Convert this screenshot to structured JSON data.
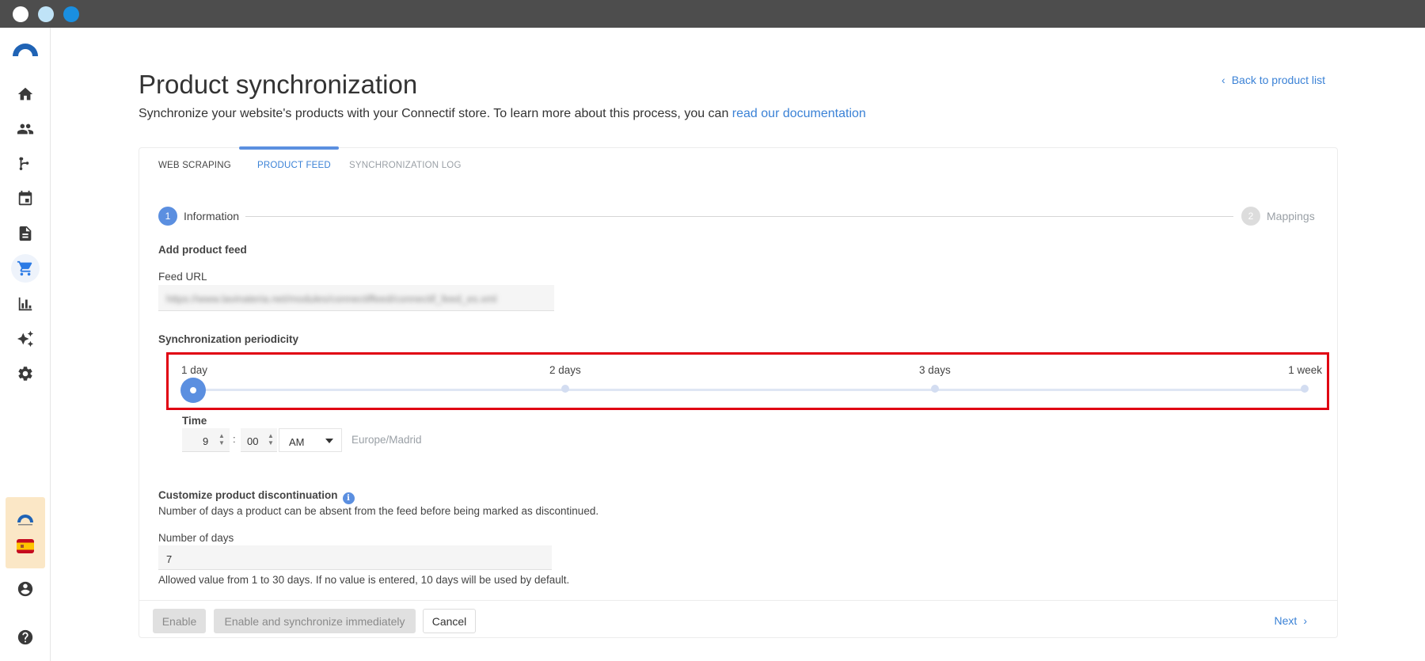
{
  "window": {
    "title": ""
  },
  "sidebar": {
    "items": [
      {
        "name": "home-icon"
      },
      {
        "name": "contacts-icon"
      },
      {
        "name": "workflow-icon"
      },
      {
        "name": "calendar-icon"
      },
      {
        "name": "document-icon"
      },
      {
        "name": "cart-icon",
        "active": true
      },
      {
        "name": "chart-icon"
      },
      {
        "name": "sparkle-icon"
      },
      {
        "name": "gear-icon"
      }
    ],
    "bottom": [
      {
        "name": "user-icon"
      },
      {
        "name": "help-icon"
      }
    ]
  },
  "header": {
    "title": "Product synchronization",
    "subtitle_text": "Synchronize your website's products with your Connectif store. To learn more about this process, you can ",
    "subtitle_link": "read our documentation",
    "back_link": "Back to product list"
  },
  "tabs": [
    {
      "label": "WEB SCRAPING",
      "state": "normal"
    },
    {
      "label": "PRODUCT FEED",
      "state": "active"
    },
    {
      "label": "SYNCHRONIZATION LOG",
      "state": "muted"
    }
  ],
  "stepper": {
    "steps": [
      {
        "number": "1",
        "label": "Information",
        "active": true
      },
      {
        "number": "2",
        "label": "Mappings",
        "active": false
      }
    ]
  },
  "form": {
    "section_title": "Add product feed",
    "feed_url_label": "Feed URL",
    "feed_url_value": "https://www.lavinateria.net/modules/connectiffeed/connectif_feed_es.xml",
    "periodicity_label": "Synchronization periodicity",
    "periodicity_options": [
      "1 day",
      "2 days",
      "3 days",
      "1 week"
    ],
    "periodicity_selected": "1 day",
    "time_label": "Time",
    "time_hour": "9",
    "time_separator": ":",
    "time_minute": "00",
    "time_ampm": "AM",
    "timezone": "Europe/Madrid",
    "discontinuation_title": "Customize product discontinuation",
    "discontinuation_info_glyph": "i",
    "discontinuation_desc": "Number of days a product can be absent from the feed before being marked as discontinued.",
    "days_label": "Number of days",
    "days_value": "7",
    "days_help": "Allowed value from 1 to 30 days. If no value is entered, 10 days will be used by default."
  },
  "footer": {
    "enable": "Enable",
    "enable_sync": "Enable and synchronize immediately",
    "cancel": "Cancel",
    "next": "Next"
  },
  "colors": {
    "accent": "#5b8fe0",
    "link": "#3b82d6",
    "highlight_frame": "#e00012",
    "account_bg": "#fbe7c6"
  }
}
